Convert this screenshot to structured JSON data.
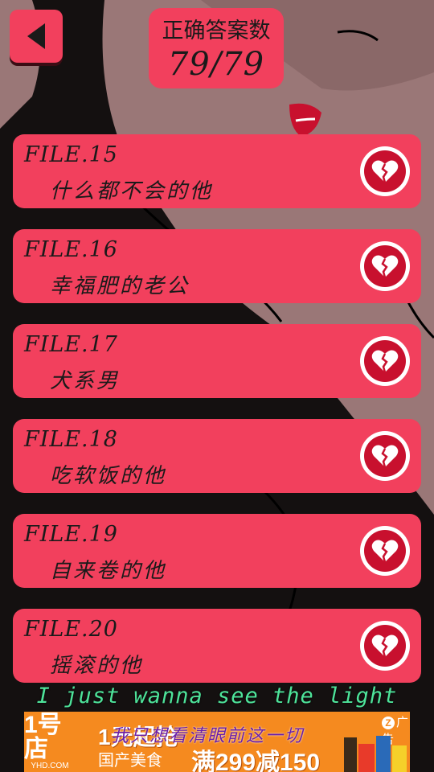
{
  "header": {
    "score_label": "正确答案数",
    "score_value": "79/79"
  },
  "files": [
    {
      "title": "FILE.15",
      "name": "什么都不会的他"
    },
    {
      "title": "FILE.16",
      "name": "幸福肥的老公"
    },
    {
      "title": "FILE.17",
      "name": "犬系男"
    },
    {
      "title": "FILE.18",
      "name": "吃软饭的他"
    },
    {
      "title": "FILE.19",
      "name": "自来卷的他"
    },
    {
      "title": "FILE.20",
      "name": "摇滚的他"
    }
  ],
  "subtitle": "I just wanna see the light",
  "ad": {
    "logo_text": "1号店",
    "logo_sub": "YHD.COM",
    "line1": "1元起抢",
    "line2": "国产美食",
    "line3": "满299减150",
    "overlay_text": "我只想看清眼前这一切",
    "badge": "广告",
    "badge_icon": "Z"
  },
  "colors": {
    "card": "#f2405d",
    "heart": "#c8102e",
    "subtitle": "#4ee39a",
    "ad": "#f58a1f"
  }
}
